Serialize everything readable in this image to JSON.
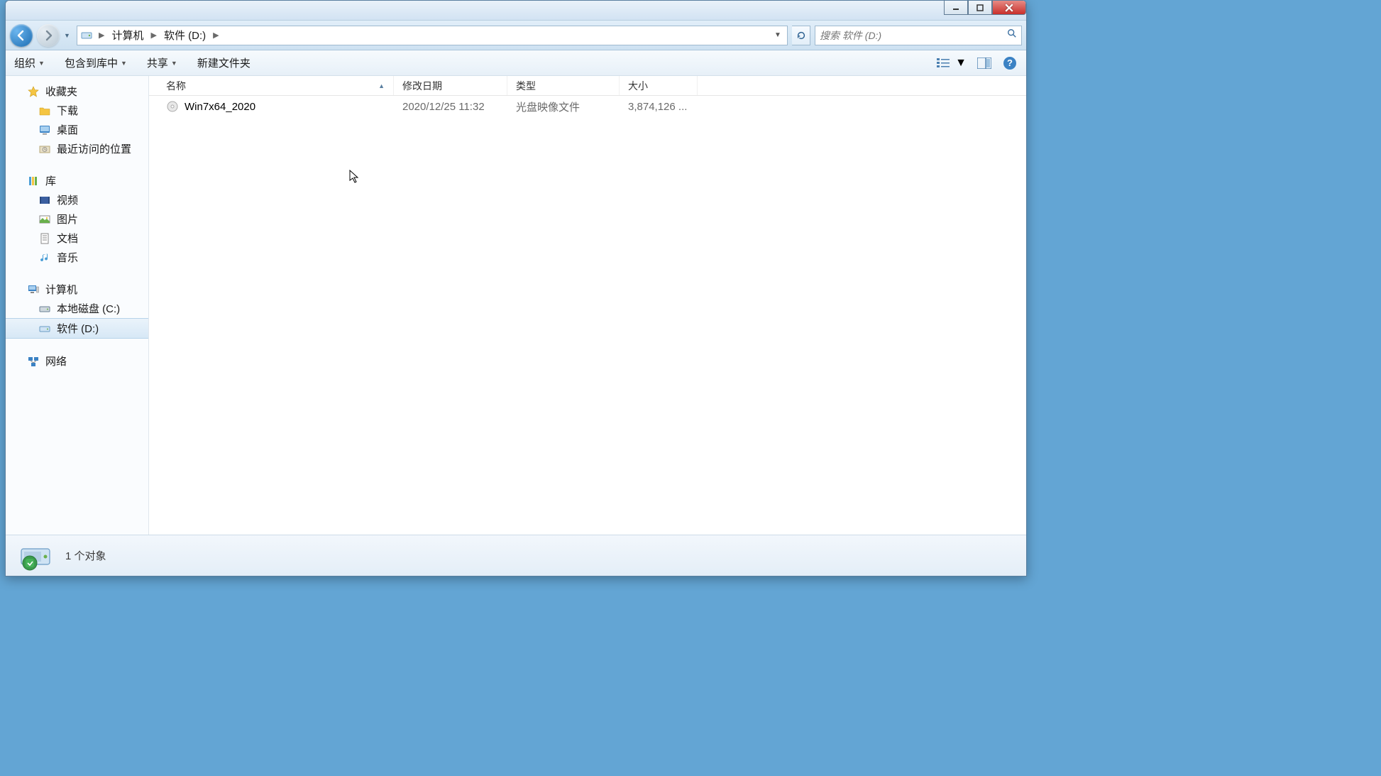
{
  "breadcrumb": {
    "root": "计算机",
    "current": "软件 (D:)"
  },
  "search": {
    "placeholder": "搜索 软件 (D:)"
  },
  "toolbar": {
    "organize": "组织",
    "include": "包含到库中",
    "share": "共享",
    "newfolder": "新建文件夹"
  },
  "columns": {
    "name": "名称",
    "date": "修改日期",
    "type": "类型",
    "size": "大小"
  },
  "nav": {
    "favorites": "收藏夹",
    "downloads": "下载",
    "desktop": "桌面",
    "recent": "最近访问的位置",
    "libraries": "库",
    "videos": "视频",
    "pictures": "图片",
    "documents": "文档",
    "music": "音乐",
    "computer": "计算机",
    "localc": "本地磁盘 (C:)",
    "software": "软件 (D:)",
    "network": "网络"
  },
  "files": [
    {
      "name": "Win7x64_2020",
      "date": "2020/12/25 11:32",
      "type": "光盘映像文件",
      "size": "3,874,126 ..."
    }
  ],
  "status": {
    "text": "1 个对象"
  }
}
